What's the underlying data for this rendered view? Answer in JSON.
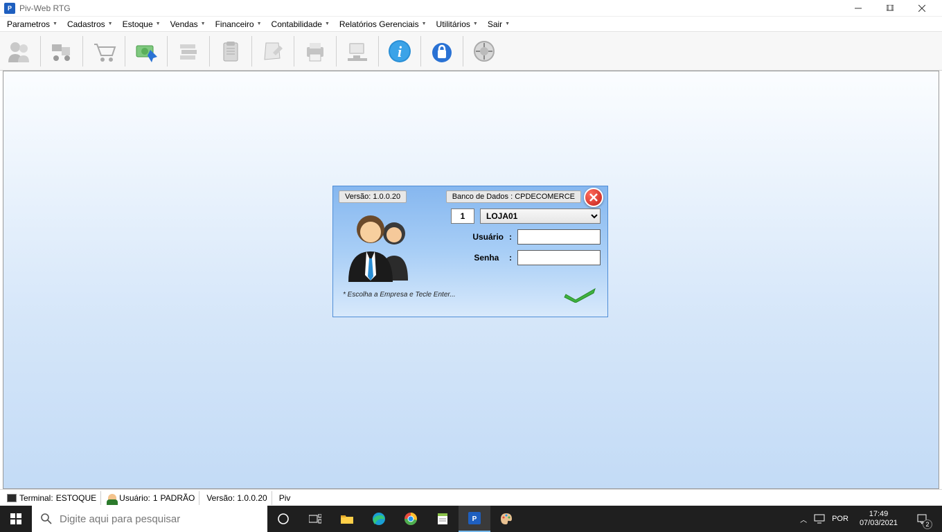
{
  "window": {
    "title": "Piv-Web  RTG"
  },
  "menus": {
    "parametros": "Parametros",
    "cadastros": "Cadastros",
    "estoque": "Estoque",
    "vendas": "Vendas",
    "financeiro": "Financeiro",
    "contabilidade": "Contabilidade",
    "relatorios": "Relatórios Gerenciais",
    "utilitarios": "Utilitários",
    "sair": "Sair"
  },
  "login": {
    "version_label": "Versão: 1.0.0.20",
    "db_label": "Banco de Dados : CPDECOMERCE",
    "company_num": "1",
    "company_name": "LOJA01",
    "user_label": "Usuário",
    "pass_label": "Senha",
    "hint": "* Escolha a Empresa e Tecle Enter..."
  },
  "status": {
    "terminal_label": "Terminal:",
    "terminal_value": "ESTOQUE",
    "user_label": "Usuário:",
    "user_num": "1",
    "user_name": "PADRÃO",
    "version": "Versão: 1.0.0.20",
    "app": "Piv"
  },
  "taskbar": {
    "search_placeholder": "Digite aqui para pesquisar",
    "lang": "POR",
    "time": "17:49",
    "date": "07/03/2021",
    "notif_count": "2"
  }
}
